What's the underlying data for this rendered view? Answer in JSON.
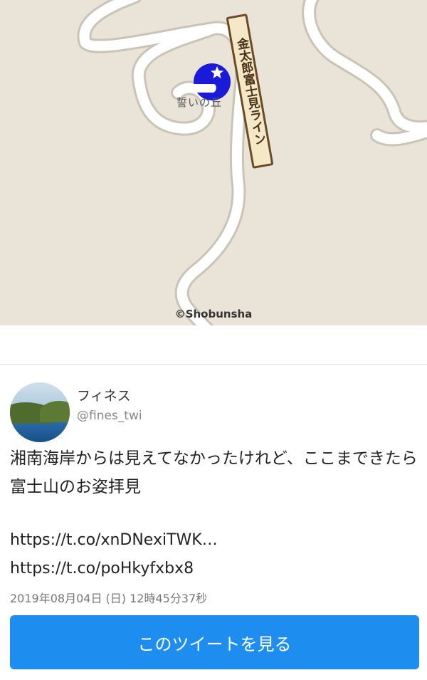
{
  "map": {
    "place_label": "誓いの丘",
    "road_label": "金太郎富士見ライン",
    "copyright": "©Shobunsha",
    "marker_icon": "helmet-star-icon",
    "marker_color": "#1a1ad8",
    "background_color": "#eae4d8"
  },
  "tweet": {
    "user_name": "フィネス",
    "user_handle": "@fines_twi",
    "text": "湘南海岸からは見えてなかったけれど、ここまできたら富士山のお姿拝見",
    "links": [
      "https://t.co/xnDNexiTWK…",
      "https://t.co/poHkyfxbx8"
    ],
    "date": "2019年08月04日 (日) 12時45分37秒",
    "view_button_label": "このツイートを見る",
    "button_color": "#1d8ef0"
  }
}
